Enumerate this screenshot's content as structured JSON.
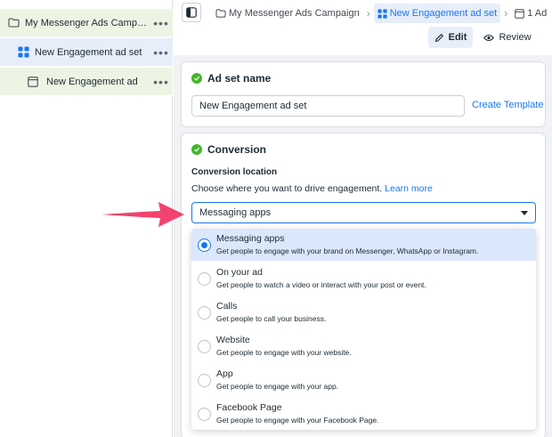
{
  "sidebar": {
    "items": [
      {
        "label": "My Messenger Ads Campaign",
        "icon": "folder-icon"
      },
      {
        "label": "New Engagement ad set",
        "icon": "grid-icon"
      },
      {
        "label": "New Engagement ad",
        "icon": "ad-icon"
      }
    ],
    "more_label": "•••"
  },
  "breadcrumb": {
    "campaign": "My Messenger Ads Campaign",
    "adset": "New Engagement ad set",
    "ad": "1 Ad"
  },
  "toolbar": {
    "edit_label": "Edit",
    "review_label": "Review"
  },
  "adset_name": {
    "title": "Ad set name",
    "value": "New Engagement ad set",
    "create_template": "Create Template"
  },
  "conversion": {
    "title": "Conversion",
    "location_label": "Conversion location",
    "description": "Choose where you want to drive engagement.",
    "learn_more": "Learn more",
    "selected": "Messaging apps",
    "options": [
      {
        "title": "Messaging apps",
        "desc": "Get people to engage with your brand on Messenger, WhatsApp or Instagram."
      },
      {
        "title": "On your ad",
        "desc": "Get people to watch a video or interact with your post or event."
      },
      {
        "title": "Calls",
        "desc": "Get people to call your business."
      },
      {
        "title": "Website",
        "desc": "Get people to engage with your website."
      },
      {
        "title": "App",
        "desc": "Get people to engage with your app."
      },
      {
        "title": "Facebook Page",
        "desc": "Get people to engage with your Facebook Page."
      }
    ]
  },
  "colors": {
    "accent": "#1877f2",
    "success": "#42b72a",
    "arrow": "#f2426e"
  }
}
